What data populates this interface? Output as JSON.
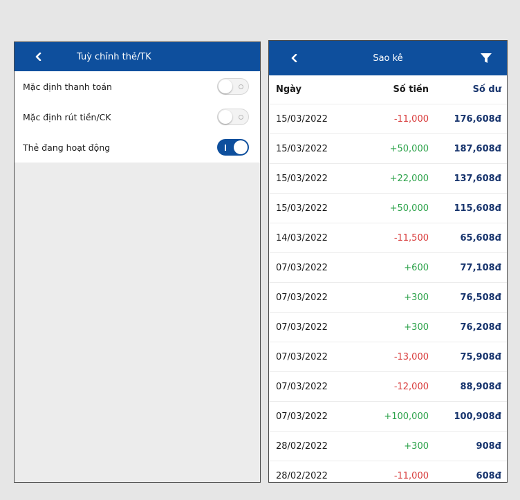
{
  "settings_screen": {
    "title": "Tuỳ chỉnh thẻ/TK",
    "items": [
      {
        "label": "Mặc định thanh toán",
        "enabled": false
      },
      {
        "label": "Mặc định rút tiền/CK",
        "enabled": false
      },
      {
        "label": "Thẻ đang hoạt động",
        "enabled": true
      }
    ]
  },
  "statement_screen": {
    "title": "Sao kê",
    "columns": {
      "date": "Ngày",
      "amount": "Số tiền",
      "balance": "Số dư"
    },
    "rows": [
      {
        "date": "15/03/2022",
        "amount": "-11,000",
        "balance": "176,608đ",
        "type": "debit"
      },
      {
        "date": "15/03/2022",
        "amount": "+50,000",
        "balance": "187,608đ",
        "type": "credit"
      },
      {
        "date": "15/03/2022",
        "amount": "+22,000",
        "balance": "137,608đ",
        "type": "credit"
      },
      {
        "date": "15/03/2022",
        "amount": "+50,000",
        "balance": "115,608đ",
        "type": "credit"
      },
      {
        "date": "14/03/2022",
        "amount": "-11,500",
        "balance": "65,608đ",
        "type": "debit"
      },
      {
        "date": "07/03/2022",
        "amount": "+600",
        "balance": "77,108đ",
        "type": "credit"
      },
      {
        "date": "07/03/2022",
        "amount": "+300",
        "balance": "76,508đ",
        "type": "credit"
      },
      {
        "date": "07/03/2022",
        "amount": "+300",
        "balance": "76,208đ",
        "type": "credit"
      },
      {
        "date": "07/03/2022",
        "amount": "-13,000",
        "balance": "75,908đ",
        "type": "debit"
      },
      {
        "date": "07/03/2022",
        "amount": "-12,000",
        "balance": "88,908đ",
        "type": "debit"
      },
      {
        "date": "07/03/2022",
        "amount": "+100,000",
        "balance": "100,908đ",
        "type": "credit"
      },
      {
        "date": "28/02/2022",
        "amount": "+300",
        "balance": "908đ",
        "type": "credit"
      },
      {
        "date": "28/02/2022",
        "amount": "-11,000",
        "balance": "608đ",
        "type": "debit"
      }
    ]
  },
  "icons": {
    "back": "chevron-left-icon",
    "filter": "filter-funnel-icon"
  },
  "colors": {
    "header_bg": "#0e4f9d",
    "debit": "#d83a3a",
    "credit": "#2ca24a",
    "balance": "#17346d",
    "page_bg": "#e6e6e6"
  }
}
